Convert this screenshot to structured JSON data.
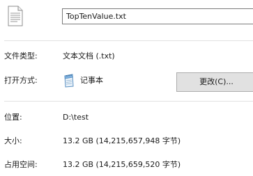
{
  "file": {
    "icon": "text-file-icon",
    "name": "TopTenValue.txt"
  },
  "properties": {
    "type_label": "文件类型:",
    "type_value": "文本文档 (.txt)",
    "open_with_label": "打开方式:",
    "open_with_app_icon": "notepad-icon",
    "open_with_app": "记事本",
    "change_button": "更改(C)...",
    "location_label": "位置:",
    "location_value": "D:\\test",
    "size_label": "大小:",
    "size_value": "13.2 GB (14,215,657,948 字节)",
    "disk_size_label": "占用空间:",
    "disk_size_value": "13.2 GB (14,215,659,520 字节)"
  }
}
